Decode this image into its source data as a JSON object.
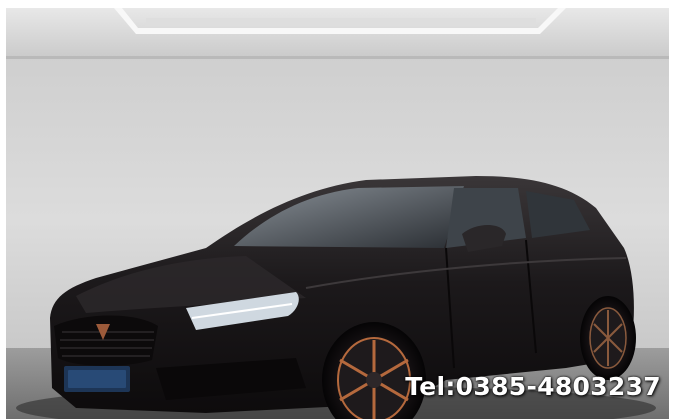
{
  "overlay": {
    "phone": "Tel:0385-4803237"
  },
  "colors": {
    "wall": "#d4d4d4",
    "ceiling_light": "#f6f6f6",
    "car_body": "#1a1719",
    "wheel_accent": "#b5693d",
    "headlight": "#cfd8e0",
    "text": "#ffffff"
  }
}
